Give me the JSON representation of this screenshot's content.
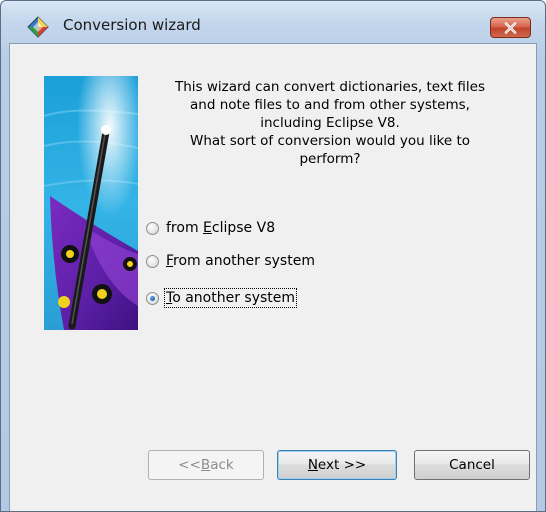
{
  "window": {
    "title": "Conversion wizard"
  },
  "intro": {
    "lines": [
      "This wizard can convert dictionaries, text files",
      "and note files to and from other systems,",
      "including Eclipse V8.",
      "What sort of conversion would you like to",
      "perform?"
    ]
  },
  "options": [
    {
      "mnemonic": "",
      "prefix": "from ",
      "key": "E",
      "rest": "clipse V8",
      "checked": false
    },
    {
      "mnemonic": "F",
      "prefix": "",
      "key": "F",
      "rest": "rom another system",
      "checked": false
    },
    {
      "mnemonic": "T",
      "prefix": "",
      "key": "T",
      "rest": "o another system",
      "checked": true
    }
  ],
  "buttons": {
    "back_prefix": "<< ",
    "back_key": "B",
    "back_rest": "ack",
    "next_key": "N",
    "next_rest": "ext >>",
    "cancel": "Cancel"
  },
  "colors": {
    "title_bar_top": "#d9e7f5",
    "title_bar_bottom": "#b4cae4",
    "close_button": "#c0432a",
    "dialog_bg": "#f0f0f0",
    "default_button_border": "#3c7fb1"
  },
  "icons": {
    "title": "diamond-app-icon",
    "close": "close-icon",
    "banner": "magic-wand-banner"
  }
}
